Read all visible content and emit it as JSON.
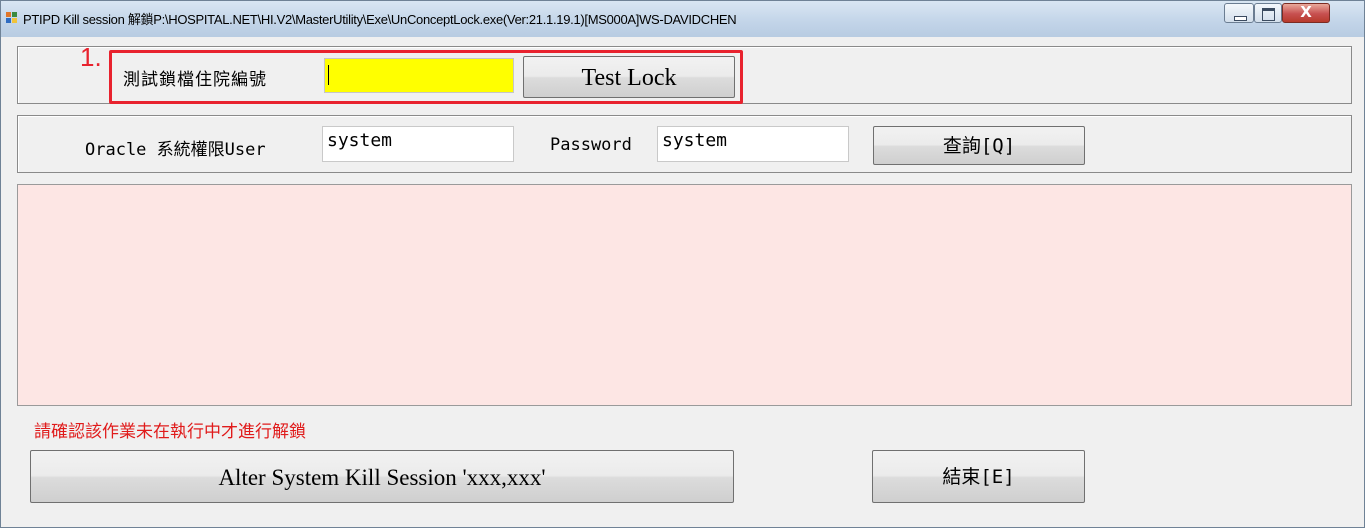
{
  "window": {
    "title": "PTIPD Kill session 解鎖P:\\HOSPITAL.NET\\HI.V2\\MasterUtility\\Exe\\UnConceptLock.exe(Ver:21.1.19.1)[MS000A]WS-DAVIDCHEN",
    "close_glyph": "X"
  },
  "test_lock": {
    "step_number": "1.",
    "label": "測試鎖檔住院編號",
    "admission_no_value": "",
    "button_label": "Test Lock"
  },
  "oracle": {
    "user_label": "Oracle 系統權限User",
    "user_value": "system",
    "password_label": "Password",
    "password_value": "system",
    "query_button": "查詢[Q]"
  },
  "result_area": {
    "rows": []
  },
  "footer": {
    "warning_text": "請確認該作業未在執行中才進行解鎖",
    "kill_button": "Alter System Kill Session 'xxx,xxx'",
    "exit_button": "結束[E]"
  },
  "colors": {
    "highlight": "#e8222e",
    "input_highlight": "#ffff00",
    "result_background": "#fde6e4",
    "warning_text": "#e01b1b"
  }
}
